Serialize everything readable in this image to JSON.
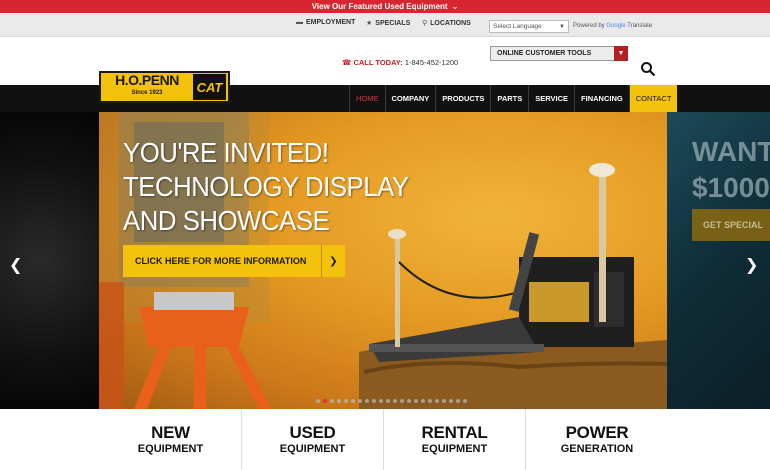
{
  "topbar": {
    "text": "View Our Featured Used Equipment"
  },
  "utility": {
    "links": [
      {
        "label": "EMPLOYMENT",
        "icon": "briefcase-icon"
      },
      {
        "label": "SPECIALS",
        "icon": "star-icon"
      },
      {
        "label": "LOCATIONS",
        "icon": "map-pin-icon"
      }
    ],
    "language_select": "Select Language",
    "powered_prefix": "Powered by",
    "powered_brand": "Google",
    "powered_suffix": "Translate"
  },
  "header": {
    "call_label": "CALL TODAY:",
    "phone": "1-845-452-1200",
    "tools_select": "ONLINE CUSTOMER TOOLS"
  },
  "logo": {
    "name": "H.O.PENN",
    "since": "Since 1923",
    "cat": "CAT"
  },
  "nav": {
    "items": [
      {
        "label": "HOME"
      },
      {
        "label": "COMPANY"
      },
      {
        "label": "PRODUCTS"
      },
      {
        "label": "PARTS"
      },
      {
        "label": "SERVICE"
      },
      {
        "label": "FINANCING"
      },
      {
        "label": "CONTACT"
      }
    ]
  },
  "hero": {
    "headline_lines": [
      "YOU'RE INVITED!",
      "TECHNOLOGY DISPLAY",
      "AND SHOWCASE"
    ],
    "cta": "CLICK HERE FOR MORE INFORMATION",
    "next_slide_lines": [
      "WANT",
      "$1000"
    ],
    "next_slide_cta": "GET SPECIAL",
    "slide_count": 22,
    "active_slide": 2
  },
  "categories": [
    {
      "big": "NEW",
      "small": "EQUIPMENT"
    },
    {
      "big": "USED",
      "small": "EQUIPMENT"
    },
    {
      "big": "RENTAL",
      "small": "EQUIPMENT"
    },
    {
      "big": "POWER",
      "small": "GENERATION"
    }
  ],
  "colors": {
    "brand_red": "#d7262f",
    "cat_yellow": "#f4c20d",
    "nav_black": "#111111"
  }
}
